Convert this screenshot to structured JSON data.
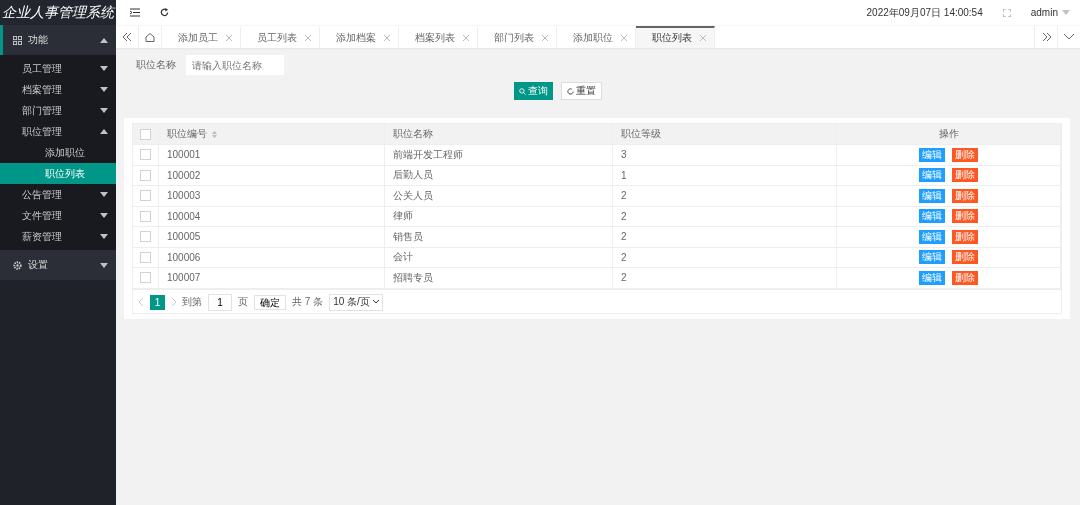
{
  "app_title": "企业人事管理系统",
  "header": {
    "datetime": "2022年09月07日  14:00:54",
    "user": "admin"
  },
  "sidebar": {
    "items": [
      {
        "label": "功能",
        "expanded": true,
        "selected": false,
        "children": [
          {
            "label": "员工管理",
            "expanded": false,
            "selected": false
          },
          {
            "label": "档案管理",
            "expanded": false,
            "selected": false
          },
          {
            "label": "部门管理",
            "expanded": false,
            "selected": false
          },
          {
            "label": "职位管理",
            "expanded": true,
            "selected": false,
            "children": [
              {
                "label": "添加职位",
                "selected": false
              },
              {
                "label": "职位列表",
                "selected": true
              }
            ]
          },
          {
            "label": "公告管理",
            "expanded": false,
            "selected": false
          },
          {
            "label": "文件管理",
            "expanded": false,
            "selected": false
          },
          {
            "label": "薪资管理",
            "expanded": false,
            "selected": false
          }
        ]
      },
      {
        "label": "设置",
        "expanded": false,
        "selected": false
      }
    ]
  },
  "tabs": [
    {
      "label": "添加员工",
      "selected": false
    },
    {
      "label": "员工列表",
      "selected": false
    },
    {
      "label": "添加档案",
      "selected": false
    },
    {
      "label": "档案列表",
      "selected": false
    },
    {
      "label": "部门列表",
      "selected": false
    },
    {
      "label": "添加职位",
      "selected": false
    },
    {
      "label": "职位列表",
      "selected": true
    }
  ],
  "search": {
    "label": "职位名称",
    "placeholder": "请输入职位名称",
    "query_button": "查询",
    "reset_button": "重置"
  },
  "table": {
    "header_checked": false,
    "columns": [
      "职位编号",
      "职位名称",
      "职位等级",
      "操作"
    ],
    "rows": [
      {
        "checked": false,
        "id": "100001",
        "name": "前端开发工程师",
        "level": "3",
        "edit": "编辑",
        "delete": "删除"
      },
      {
        "checked": false,
        "id": "100002",
        "name": "后勤人员",
        "level": "1",
        "edit": "编辑",
        "delete": "删除"
      },
      {
        "checked": false,
        "id": "100003",
        "name": "公关人员",
        "level": "2",
        "edit": "编辑",
        "delete": "删除"
      },
      {
        "checked": false,
        "id": "100004",
        "name": "律师",
        "level": "2",
        "edit": "编辑",
        "delete": "删除"
      },
      {
        "checked": false,
        "id": "100005",
        "name": "销售员",
        "level": "2",
        "edit": "编辑",
        "delete": "删除"
      },
      {
        "checked": false,
        "id": "100006",
        "name": "会计",
        "level": "2",
        "edit": "编辑",
        "delete": "删除"
      },
      {
        "checked": false,
        "id": "100007",
        "name": "招聘专员",
        "level": "2",
        "edit": "编辑",
        "delete": "删除"
      }
    ]
  },
  "pagination": {
    "pages": [
      {
        "label": "1",
        "selected": true
      }
    ],
    "goto_label": "到第",
    "goto_value": "1",
    "page_unit": "页",
    "confirm": "确定",
    "total": "共 7 条",
    "page_size": "10 条/页"
  }
}
